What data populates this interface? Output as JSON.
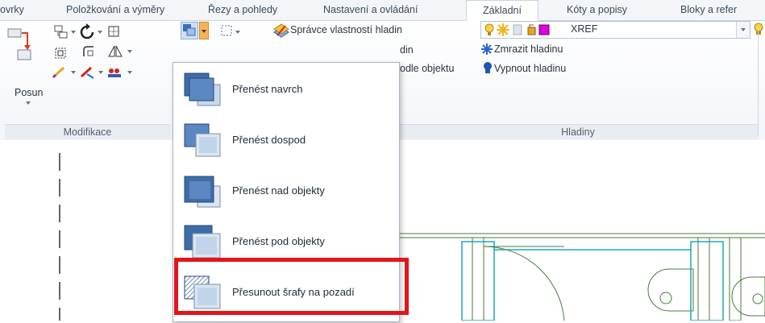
{
  "tabs": [
    {
      "label": "ovrky"
    },
    {
      "label": "Položkování a výměry"
    },
    {
      "label": "Řezy a pohledy"
    },
    {
      "label": "Nastavení a ovládání"
    },
    {
      "label": "Základní",
      "active": true
    },
    {
      "label": "Kóty a popisy"
    },
    {
      "label": "Bloky a refer"
    }
  ],
  "modifikace": {
    "posun_label": "Posun",
    "panel_label": "Modifikace"
  },
  "hladiny": {
    "spravce_label": "Správce vlastností hladin",
    "line2_partial": "din",
    "line3_partial": "odle objektu",
    "zmrazit_label": "Zmrazit hladinu",
    "vypnout_label": "Vypnout hladinu",
    "layer_name": "XREF",
    "layer_color": "#e000e0",
    "panel_label": "Hladiny"
  },
  "dropdown": {
    "items": [
      {
        "label": "Přenést navrch",
        "icon": "bring-to-front-icon"
      },
      {
        "label": "Přenést dospod",
        "icon": "send-to-back-icon"
      },
      {
        "label": "Přenést nad objekty",
        "icon": "bring-above-objects-icon"
      },
      {
        "label": "Přenést pod objekty",
        "icon": "send-under-objects-icon"
      },
      {
        "label": "Přesunout šrafy na pozadí",
        "icon": "hatch-to-background-icon",
        "highlighted": true
      }
    ]
  },
  "colors": {
    "highlight": "#e4141b",
    "accent_blue": "#3c6eb4",
    "drawing_teal": "#1aa8b8",
    "drawing_green": "#4a7a3a"
  }
}
